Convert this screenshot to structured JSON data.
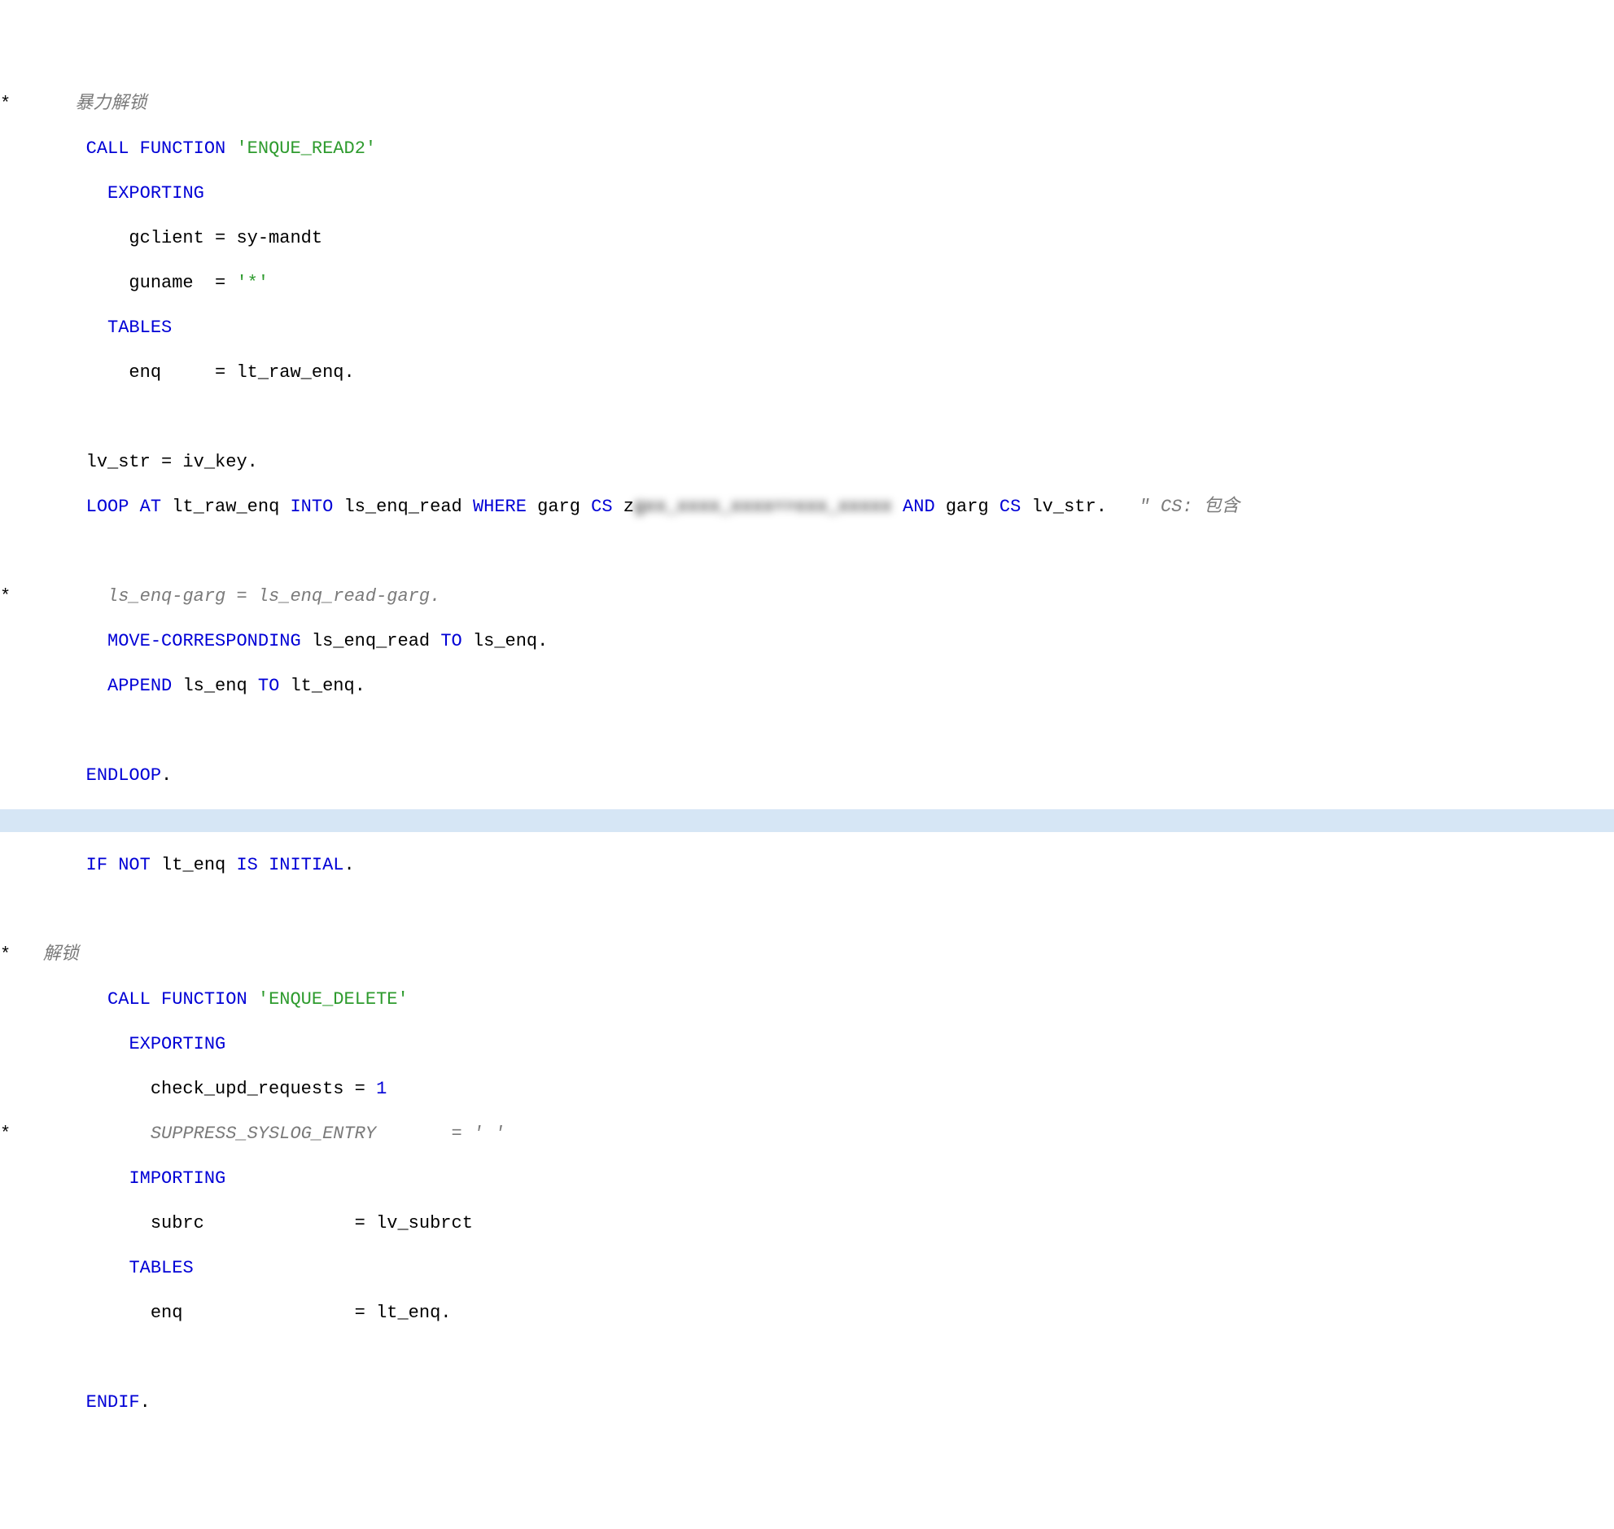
{
  "lines": {
    "l01_star": "*",
    "l01_com": "      暴力解锁",
    "l02_spaces": "        ",
    "l02_kw1": "CALL FUNCTION",
    "l02_str": " 'ENQUE_READ2'",
    "l03_spaces": "          ",
    "l03_kw": "EXPORTING",
    "l04": "            gclient = sy-mandt",
    "l05_a": "            guname  = ",
    "l05_s": "'*'",
    "l06_spaces": "          ",
    "l06_kw": "TABLES",
    "l07": "            enq     = lt_raw_enq.",
    "l08": " ",
    "l09": "        lv_str = iv_key.",
    "l10_sp": "        ",
    "l10_kw1": "LOOP AT",
    "l10_t1": " lt_raw_enq ",
    "l10_kw2": "INTO",
    "l10_t2": " ls_enq_read ",
    "l10_kw3": "WHERE",
    "l10_t3": " garg ",
    "l10_kw4": "CS",
    "l10_t4": " z",
    "l10_blur": "gxx_xxxx_xxxx=>xxx_xxxxx",
    "l10_t5": " ",
    "l10_kw5": "AND",
    "l10_t6": " garg ",
    "l10_kw6": "CS",
    "l10_t7": " lv_str.   ",
    "l10_com": "\" CS: 包含",
    "l11": " ",
    "l12_star": "*",
    "l12_com": "         ls_enq-garg = ls_enq_read-garg.",
    "l13_sp": "          ",
    "l13_kw1": "MOVE-CORRESPONDING",
    "l13_t1": " ls_enq_read ",
    "l13_kw2": "TO",
    "l13_t2": " ls_enq.",
    "l14_sp": "          ",
    "l14_kw1": "APPEND",
    "l14_t1": " ls_enq ",
    "l14_kw2": "TO",
    "l14_t2": " lt_enq.",
    "l15": " ",
    "l16_sp": "        ",
    "l16_kw": "ENDLOOP",
    "l16_t": ".",
    "l17": " ",
    "l18_sp": "        ",
    "l18_kw1": "IF NOT",
    "l18_t1": " lt_enq ",
    "l18_kw2": "IS INITIAL",
    "l18_t2": ".",
    "l19": " ",
    "l20_star": "*",
    "l20_com": "   解锁",
    "l21_sp": "          ",
    "l21_kw": "CALL FUNCTION",
    "l21_str": " 'ENQUE_DELETE'",
    "l22_sp": "            ",
    "l22_kw": "EXPORTING",
    "l23_t": "              check_upd_requests = ",
    "l23_kw": "1",
    "l24_star": "*",
    "l24_com": "             SUPPRESS_SYSLOG_ENTRY       = ' '",
    "l25_sp": "            ",
    "l25_kw": "IMPORTING",
    "l26": "              subrc              = lv_subrct",
    "l27_sp": "            ",
    "l27_kw": "TABLES",
    "l28": "              enq                = lt_enq.",
    "l29": " ",
    "l30_sp": "        ",
    "l30_kw": "ENDIF",
    "l30_t": "."
  }
}
